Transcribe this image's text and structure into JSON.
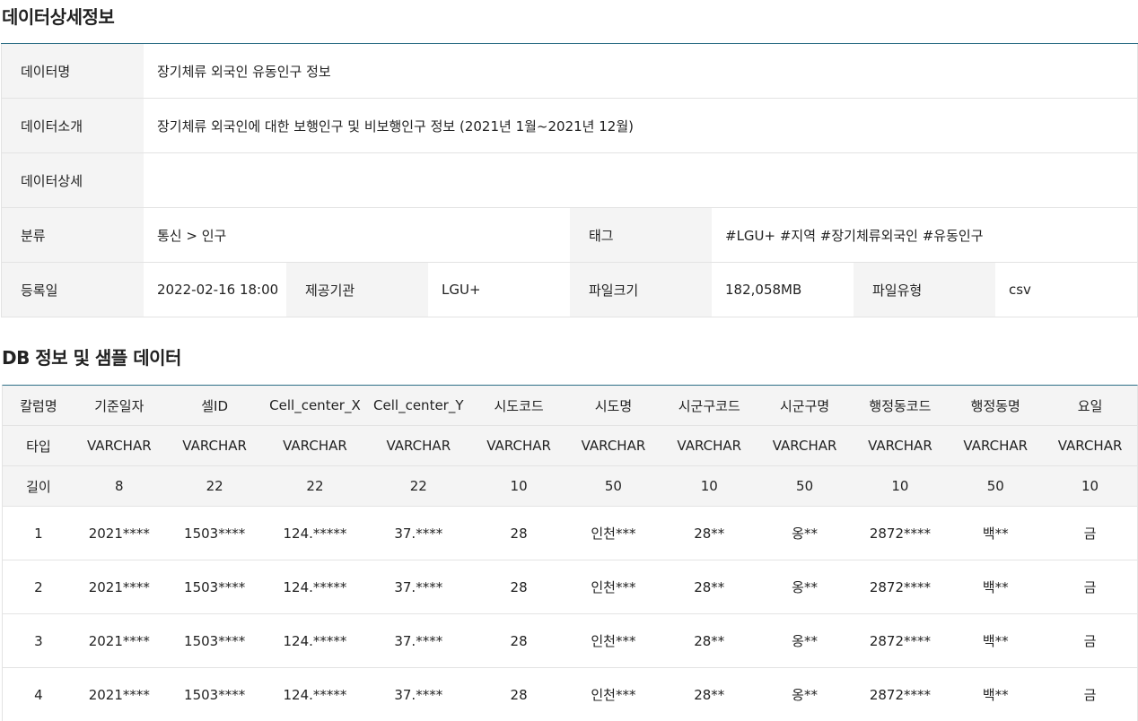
{
  "detail_section": {
    "title": "데이터상세정보",
    "data_name_label": "데이터명",
    "data_name_value": "장기체류 외국인 유동인구 정보",
    "intro_label": "데이터소개",
    "intro_value": "장기체류 외국인에 대한 보행인구 및 비보행인구 정보 (2021년 1월~2021년 12월)",
    "detail_label": "데이터상세",
    "detail_value": "",
    "category_label": "분류",
    "category_value": "통신 > 인구",
    "tag_label": "태그",
    "tag_value": "#LGU+ #지역 #장기체류외국인 #유동인구",
    "reg_date_label": "등록일",
    "reg_date_value": "2022-02-16 18:00",
    "provider_label": "제공기관",
    "provider_value": "LGU+",
    "file_size_label": "파일크기",
    "file_size_value": "182,058MB",
    "file_type_label": "파일유형",
    "file_type_value": "csv"
  },
  "db_section": {
    "title": "DB 정보 및 샘플 데이터",
    "columns": [
      "칼럼명",
      "기준일자",
      "셀ID",
      "Cell_center_X",
      "Cell_center_Y",
      "시도코드",
      "시도명",
      "시군구코드",
      "시군구명",
      "행정동코드",
      "행정동명",
      "요일"
    ],
    "types": [
      "타입",
      "VARCHAR",
      "VARCHAR",
      "VARCHAR",
      "VARCHAR",
      "VARCHAR",
      "VARCHAR",
      "VARCHAR",
      "VARCHAR",
      "VARCHAR",
      "VARCHAR",
      "VARCHAR"
    ],
    "lengths": [
      "길이",
      "8",
      "22",
      "22",
      "22",
      "10",
      "50",
      "10",
      "50",
      "10",
      "50",
      "10"
    ],
    "rows": [
      [
        "1",
        "2021****",
        "1503****",
        "124.*****",
        "37.****",
        "28",
        "인천***",
        "28**",
        "옹**",
        "2872****",
        "백**",
        "금"
      ],
      [
        "2",
        "2021****",
        "1503****",
        "124.*****",
        "37.****",
        "28",
        "인천***",
        "28**",
        "옹**",
        "2872****",
        "백**",
        "금"
      ],
      [
        "3",
        "2021****",
        "1503****",
        "124.*****",
        "37.****",
        "28",
        "인천***",
        "28**",
        "옹**",
        "2872****",
        "백**",
        "금"
      ],
      [
        "4",
        "2021****",
        "1503****",
        "124.*****",
        "37.****",
        "28",
        "인천***",
        "28**",
        "옹**",
        "2872****",
        "백**",
        "금"
      ]
    ]
  }
}
